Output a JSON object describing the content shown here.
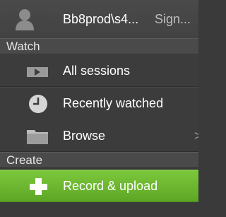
{
  "account": {
    "name": "Bb8prod\\s4...",
    "sign_out_label": "Sign..."
  },
  "sections": {
    "watch": "Watch",
    "create": "Create"
  },
  "items": {
    "all_sessions": "All sessions",
    "recently_watched": "Recently watched",
    "browse": "Browse",
    "browse_chevron": ">",
    "record_upload": "Record & upload"
  },
  "colors": {
    "background": "#3a3a3a",
    "active": "#6bb42f"
  }
}
